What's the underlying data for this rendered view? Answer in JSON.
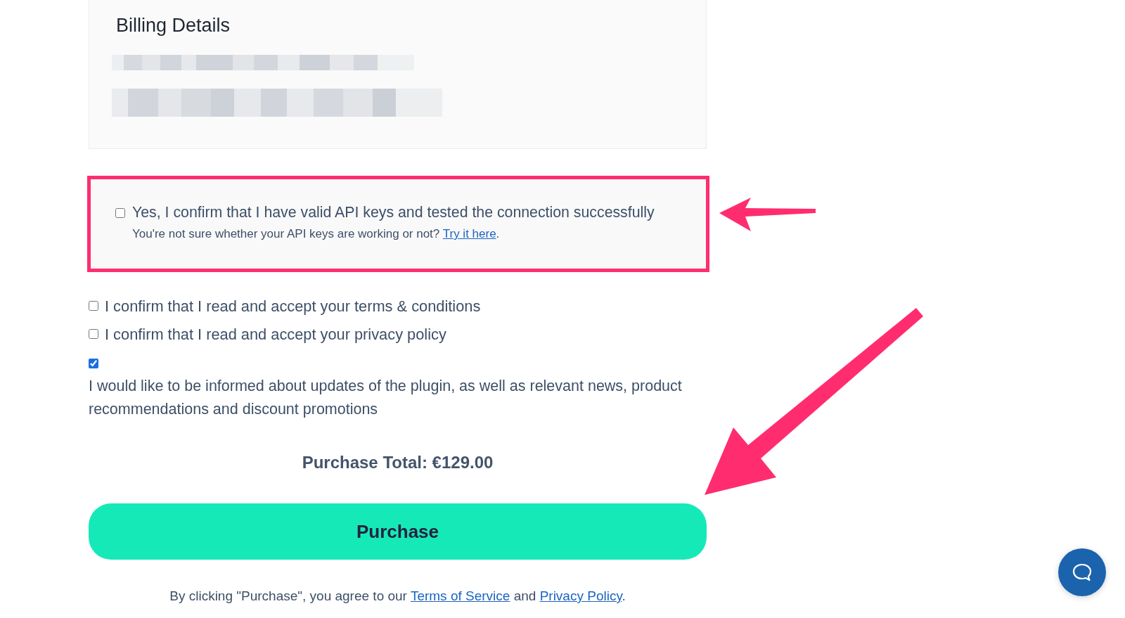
{
  "billing": {
    "title": "Billing Details"
  },
  "api_confirmation": {
    "highlighted": true,
    "label": "Yes, I confirm that I have valid API keys and tested the connection successfully",
    "checked": false,
    "hint": {
      "text": "You're not sure whether your API keys are working or not?",
      "link": "Try it here",
      "after": "."
    }
  },
  "consents": [
    {
      "kind": "inline",
      "label": "I confirm that I read and accept your terms & conditions",
      "checked": false
    },
    {
      "kind": "inline",
      "label": "I confirm that I read and accept your privacy policy",
      "checked": false
    },
    {
      "kind": "stacked",
      "label": "I would like to be informed about updates of the plugin, as well as relevant news, product recommendations and discount promotions",
      "checked": true
    }
  ],
  "purchase_total": "Purchase Total: €129.00",
  "purchase_button": "Purchase",
  "legal_notice": {
    "before": "By clicking \"Purchase\", you agree to our",
    "terms_link": "Terms of Service",
    "between": "and",
    "privacy_link": "Privacy Policy",
    "after": "."
  }
}
